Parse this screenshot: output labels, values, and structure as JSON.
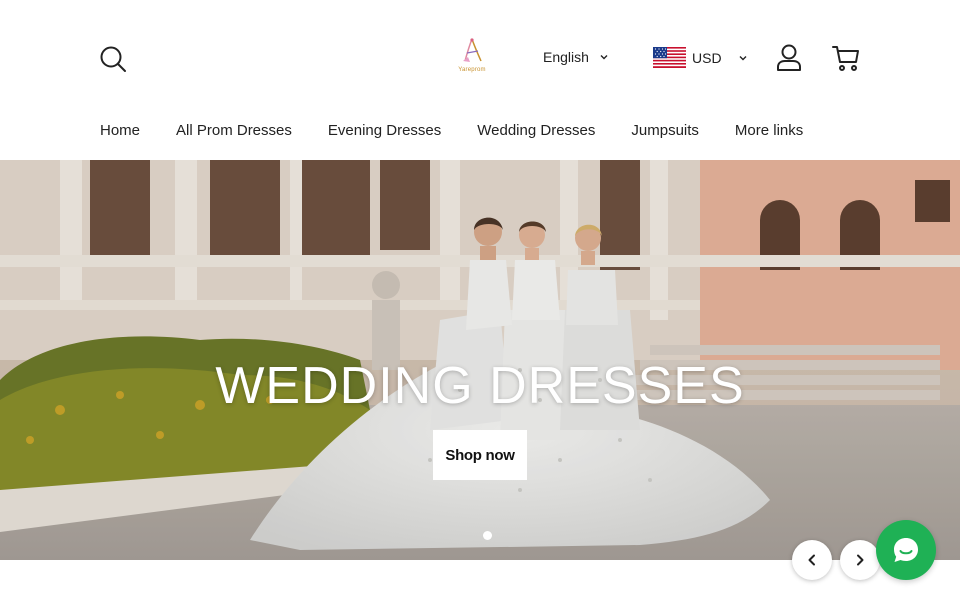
{
  "header": {
    "logo_text": "Yareprom",
    "language": "English",
    "currency": "USD",
    "icons": {
      "search": "search-icon",
      "account": "user-icon",
      "cart": "cart-icon",
      "flag": "us-flag-icon"
    }
  },
  "nav": {
    "items": [
      {
        "label": "Home"
      },
      {
        "label": "All Prom Dresses"
      },
      {
        "label": "Evening Dresses"
      },
      {
        "label": "Wedding Dresses"
      },
      {
        "label": "Jumpsuits"
      },
      {
        "label": "More links"
      }
    ]
  },
  "hero": {
    "title": "WEDDING DRESSES",
    "button_label": "Shop now",
    "slide_count": 1,
    "active_slide": 1
  },
  "controls": {
    "prev_icon": "chevron-left-icon",
    "next_icon": "chevron-right-icon",
    "chat_icon": "chat-icon"
  },
  "colors": {
    "chat_button": "#1fb155",
    "text": "#222222",
    "logo_accent": "#c8922f"
  }
}
